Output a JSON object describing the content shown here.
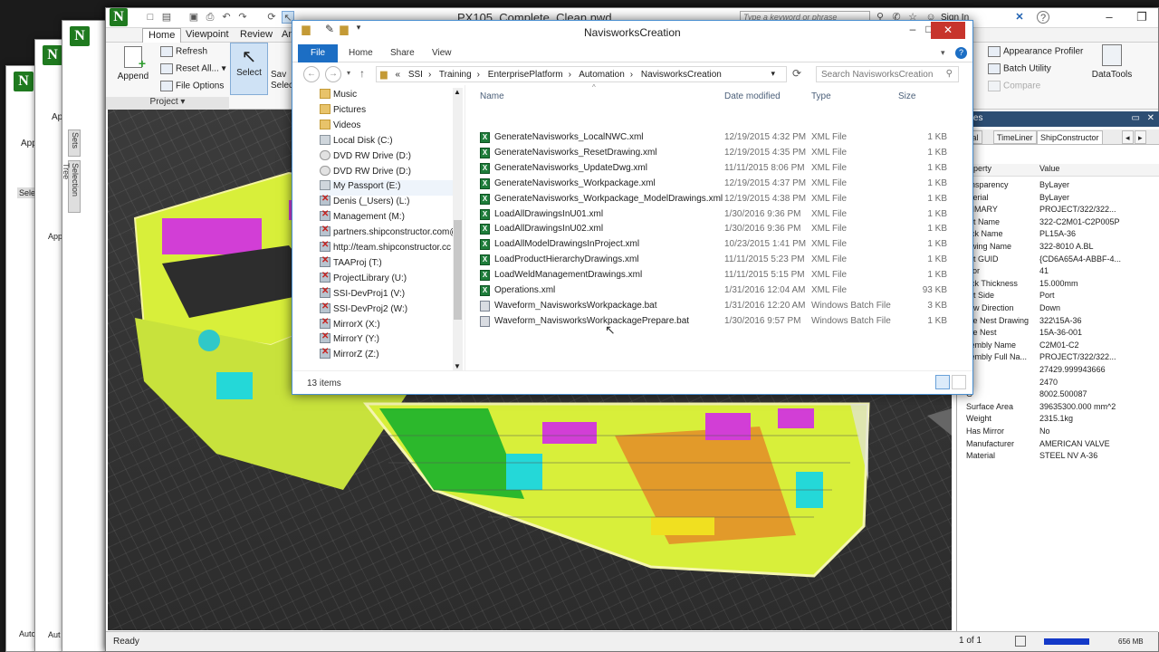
{
  "navisworks": {
    "title": "PX105_Complete_Clean.nwd",
    "search_placeholder": "Type a keyword or phrase",
    "sign_in": "Sign In",
    "tabs": [
      "Home",
      "Viewpoint",
      "Review",
      "An"
    ],
    "ribbon": {
      "append": "Append",
      "refresh": "Refresh",
      "reset_all": "Reset All...",
      "file_options": "File Options",
      "project": "Project",
      "select": "Select",
      "save_select": "Sav Select",
      "appearance_profiler": "Appearance Profiler",
      "batch_utility": "Batch Utility",
      "compare": "Compare",
      "datatools": "DataTools"
    },
    "side_tabs": [
      "Sets",
      "Selection Tree"
    ],
    "status": "Ready",
    "page": "1 of 1",
    "memory": "656 MB"
  },
  "bg_windows": {
    "labels": [
      "App",
      "Ap",
      "Appe",
      "Selec",
      "Sta",
      "Auto",
      "Aut",
      "Ready"
    ]
  },
  "properties": {
    "header": "erties",
    "tabs": [
      "terial",
      "TimeLiner",
      "ShipConstructor"
    ],
    "col_property": "roperty",
    "col_value": "Value",
    "rows": [
      [
        "ansparency",
        "ByLayer"
      ],
      [
        "aterial",
        "ByLayer"
      ],
      [
        "RIMARY",
        "PROJECT/322/322..."
      ],
      [
        "art Name",
        "322-C2M01-C2P005P"
      ],
      [
        "ock Name",
        "PL15A-36"
      ],
      [
        "awing Name",
        "322-8010 A.BL"
      ],
      [
        "art GUID",
        "{CD6A65A4-ABBF-4..."
      ],
      [
        "olor",
        "41"
      ],
      [
        "ock Thickness",
        "15.000mm"
      ],
      [
        "art Side",
        "Port"
      ],
      [
        "row Direction",
        "Down"
      ],
      [
        "ate Nest Drawing",
        "322\\15A-36"
      ],
      [
        "ate Nest",
        "15A-36-001"
      ],
      [
        "sembly Name",
        "C2M01-C2"
      ],
      [
        "sembly Full Na...",
        "PROJECT/322/322..."
      ],
      [
        "G",
        "27429.999943666"
      ],
      [
        "G",
        "2470"
      ],
      [
        "G",
        "8002.500087"
      ],
      [
        "Surface Area",
        "39635300.000 mm^2"
      ],
      [
        "Weight",
        "2315.1kg"
      ],
      [
        "Has Mirror",
        "No"
      ],
      [
        "Manufacturer",
        "AMERICAN VALVE"
      ],
      [
        "Material",
        "STEEL NV A-36"
      ]
    ]
  },
  "explorer": {
    "title": "NavisworksCreation",
    "tabs": [
      "File",
      "Home",
      "Share",
      "View"
    ],
    "path": [
      "«",
      "SSI",
      "Training",
      "EnterprisePlatform",
      "Automation",
      "NavisworksCreation"
    ],
    "search_placeholder": "Search NavisworksCreation",
    "tree": [
      {
        "label": "Music",
        "icon": "folder"
      },
      {
        "label": "Pictures",
        "icon": "folder"
      },
      {
        "label": "Videos",
        "icon": "folder"
      },
      {
        "label": "Local Disk (C:)",
        "icon": "disk"
      },
      {
        "label": "DVD RW Drive (D:)",
        "icon": "dvd"
      },
      {
        "label": "DVD RW Drive (D:)",
        "icon": "dvd"
      },
      {
        "label": "My Passport (E:)",
        "icon": "disk"
      },
      {
        "label": "Denis (_Users) (L:)",
        "icon": "net"
      },
      {
        "label": "Management (M:)",
        "icon": "net"
      },
      {
        "label": "partners.shipconstructor.com@",
        "icon": "net"
      },
      {
        "label": "http://team.shipconstructor.cc",
        "icon": "net"
      },
      {
        "label": "TAAProj (T:)",
        "icon": "net"
      },
      {
        "label": "ProjectLibrary (U:)",
        "icon": "net"
      },
      {
        "label": "SSI-DevProj1 (V:)",
        "icon": "net"
      },
      {
        "label": "SSI-DevProj2 (W:)",
        "icon": "net"
      },
      {
        "label": "MirrorX (X:)",
        "icon": "net"
      },
      {
        "label": "MirrorY (Y:)",
        "icon": "net"
      },
      {
        "label": "MirrorZ (Z:)",
        "icon": "net"
      }
    ],
    "columns": [
      "Name",
      "Date modified",
      "Type",
      "Size"
    ],
    "files": [
      {
        "name": "GenerateNavisworks_LocalNWC.xml",
        "date": "12/19/2015 4:32 PM",
        "type": "XML File",
        "size": "1 KB",
        "icon": "xml"
      },
      {
        "name": "GenerateNavisworks_ResetDrawing.xml",
        "date": "12/19/2015 4:35 PM",
        "type": "XML File",
        "size": "1 KB",
        "icon": "xml"
      },
      {
        "name": "GenerateNavisworks_UpdateDwg.xml",
        "date": "11/11/2015 8:06 PM",
        "type": "XML File",
        "size": "1 KB",
        "icon": "xml"
      },
      {
        "name": "GenerateNavisworks_Workpackage.xml",
        "date": "12/19/2015 4:37 PM",
        "type": "XML File",
        "size": "1 KB",
        "icon": "xml"
      },
      {
        "name": "GenerateNavisworks_Workpackage_ModelDrawings.xml",
        "date": "12/19/2015 4:38 PM",
        "type": "XML File",
        "size": "1 KB",
        "icon": "xml"
      },
      {
        "name": "LoadAllDrawingsInU01.xml",
        "date": "1/30/2016 9:36 PM",
        "type": "XML File",
        "size": "1 KB",
        "icon": "xml"
      },
      {
        "name": "LoadAllDrawingsInU02.xml",
        "date": "1/30/2016 9:36 PM",
        "type": "XML File",
        "size": "1 KB",
        "icon": "xml"
      },
      {
        "name": "LoadAllModelDrawingsInProject.xml",
        "date": "10/23/2015 1:41 PM",
        "type": "XML File",
        "size": "1 KB",
        "icon": "xml"
      },
      {
        "name": "LoadProductHierarchyDrawings.xml",
        "date": "11/11/2015 5:23 PM",
        "type": "XML File",
        "size": "1 KB",
        "icon": "xml"
      },
      {
        "name": "LoadWeldManagementDrawings.xml",
        "date": "11/11/2015 5:15 PM",
        "type": "XML File",
        "size": "1 KB",
        "icon": "xml"
      },
      {
        "name": "Operations.xml",
        "date": "1/31/2016 12:04 AM",
        "type": "XML File",
        "size": "93 KB",
        "icon": "xml"
      },
      {
        "name": "Waveform_NavisworksWorkpackage.bat",
        "date": "1/31/2016 12:20 AM",
        "type": "Windows Batch File",
        "size": "3 KB",
        "icon": "bat"
      },
      {
        "name": "Waveform_NavisworksWorkpackagePrepare.bat",
        "date": "1/30/2016 9:57 PM",
        "type": "Windows Batch File",
        "size": "1 KB",
        "icon": "bat"
      }
    ],
    "item_count": "13 items"
  }
}
